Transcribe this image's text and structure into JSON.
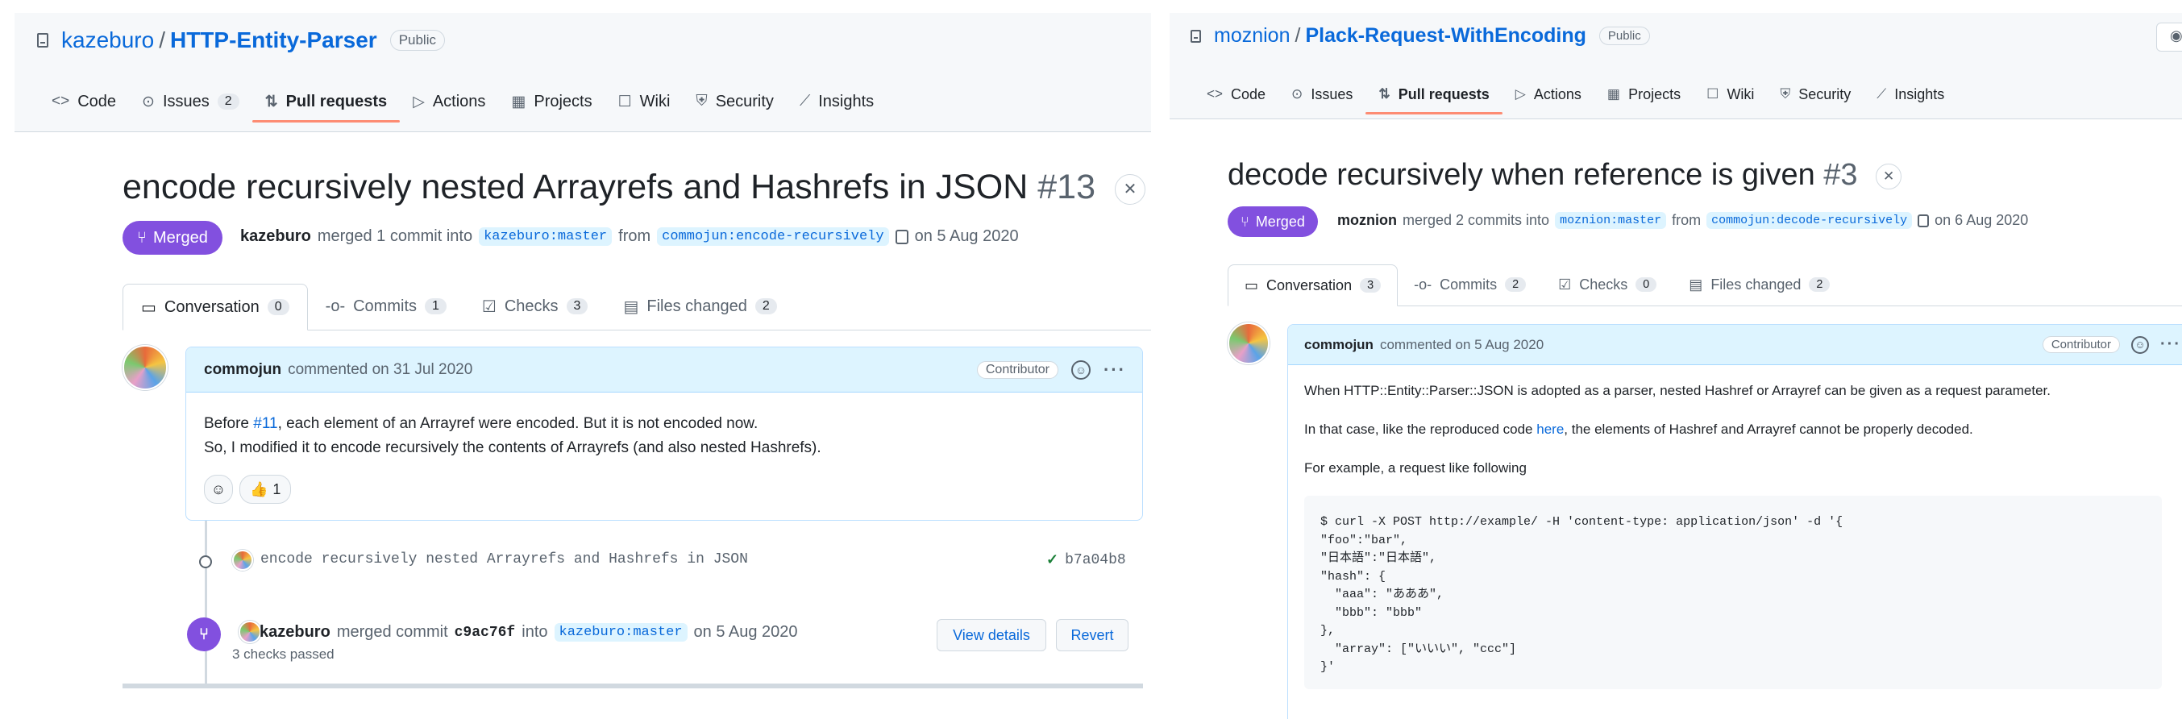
{
  "left": {
    "repo": {
      "owner": "kazeburo",
      "name": "HTTP-Entity-Parser",
      "visibility": "Public"
    },
    "nav": [
      {
        "icon": "<>",
        "label": "Code",
        "count": ""
      },
      {
        "icon": "⊙",
        "label": "Issues",
        "count": "2"
      },
      {
        "icon": "⇅",
        "label": "Pull requests",
        "count": ""
      },
      {
        "icon": "▷",
        "label": "Actions",
        "count": ""
      },
      {
        "icon": "▦",
        "label": "Projects",
        "count": ""
      },
      {
        "icon": "☐",
        "label": "Wiki",
        "count": ""
      },
      {
        "icon": "⛨",
        "label": "Security",
        "count": ""
      },
      {
        "icon": "⟋",
        "label": "Insights",
        "count": ""
      }
    ],
    "pr": {
      "title": "encode recursively nested Arrayrefs and Hashrefs in JSON",
      "number": "#13",
      "state": "Merged",
      "author": "kazeburo",
      "action": "merged 1 commit into",
      "base": "kazeburo:master",
      "from": "from",
      "head": "commojun:encode-recursively",
      "date": "on 5 Aug 2020"
    },
    "tabs": [
      {
        "label": "Conversation",
        "count": "0"
      },
      {
        "label": "Commits",
        "count": "1"
      },
      {
        "label": "Checks",
        "count": "3"
      },
      {
        "label": "Files changed",
        "count": "2"
      }
    ],
    "comment": {
      "author": "commojun",
      "meta": "commented on 31 Jul 2020",
      "badge": "Contributor",
      "line1_pre": "Before ",
      "line1_link": "#11",
      "line1_post": ", each element of an Arrayref were encoded. But it is not encoded now.",
      "line2": "So, I modified it to encode recursively the contents of Arrayrefs (and also nested Hashrefs).",
      "reaction_emoji": "👍",
      "reaction_count": "1"
    },
    "commit": {
      "message": "encode recursively nested Arrayrefs and Hashrefs in JSON",
      "sha": "b7a04b8"
    },
    "merge_event": {
      "author": "kazeburo",
      "action": "merged commit",
      "sha": "c9ac76f",
      "into": "into",
      "base": "kazeburo:master",
      "date": "on 5 Aug 2020",
      "checks": "3 checks passed",
      "view_details": "View details",
      "revert": "Revert"
    }
  },
  "right": {
    "repo": {
      "owner": "moznion",
      "name": "Plack-Request-WithEncoding",
      "visibility": "Public"
    },
    "nav": [
      {
        "icon": "<>",
        "label": "Code",
        "count": ""
      },
      {
        "icon": "⊙",
        "label": "Issues",
        "count": ""
      },
      {
        "icon": "⇅",
        "label": "Pull requests",
        "count": ""
      },
      {
        "icon": "▷",
        "label": "Actions",
        "count": ""
      },
      {
        "icon": "▦",
        "label": "Projects",
        "count": ""
      },
      {
        "icon": "☐",
        "label": "Wiki",
        "count": ""
      },
      {
        "icon": "⛨",
        "label": "Security",
        "count": ""
      },
      {
        "icon": "⟋",
        "label": "Insights",
        "count": ""
      }
    ],
    "pr": {
      "title": "decode recursively when reference is given",
      "number": "#3",
      "state": "Merged",
      "author": "moznion",
      "action": "merged 2 commits into",
      "base": "moznion:master",
      "from": "from",
      "head": "commojun:decode-recursively",
      "date": "on 6 Aug 2020"
    },
    "tabs": [
      {
        "label": "Conversation",
        "count": "3"
      },
      {
        "label": "Commits",
        "count": "2"
      },
      {
        "label": "Checks",
        "count": "0"
      },
      {
        "label": "Files changed",
        "count": "2"
      }
    ],
    "comment": {
      "author": "commojun",
      "meta": "commented on 5 Aug 2020",
      "badge": "Contributor",
      "p1": "When HTTP::Entity::Parser::JSON is adopted as a parser, nested Hashref or Arrayref can be given as a request parameter.",
      "p2_pre": "In that case, like the reproduced code ",
      "p2_link": "here",
      "p2_post": ", the elements of Hashref and Arrayref cannot be properly decoded.",
      "p3": "For example, a request like following",
      "code": "$ curl -X POST http://example/ -H 'content-type: application/json' -d '{\n\"foo\":\"bar\",\n\"日本語\":\"日本語\",\n\"hash\": {\n  \"aaa\": \"あああ\",\n  \"bbb\": \"bbb\"\n},\n  \"array\": [\"いいい\", \"ccc\"]\n}'"
    }
  }
}
